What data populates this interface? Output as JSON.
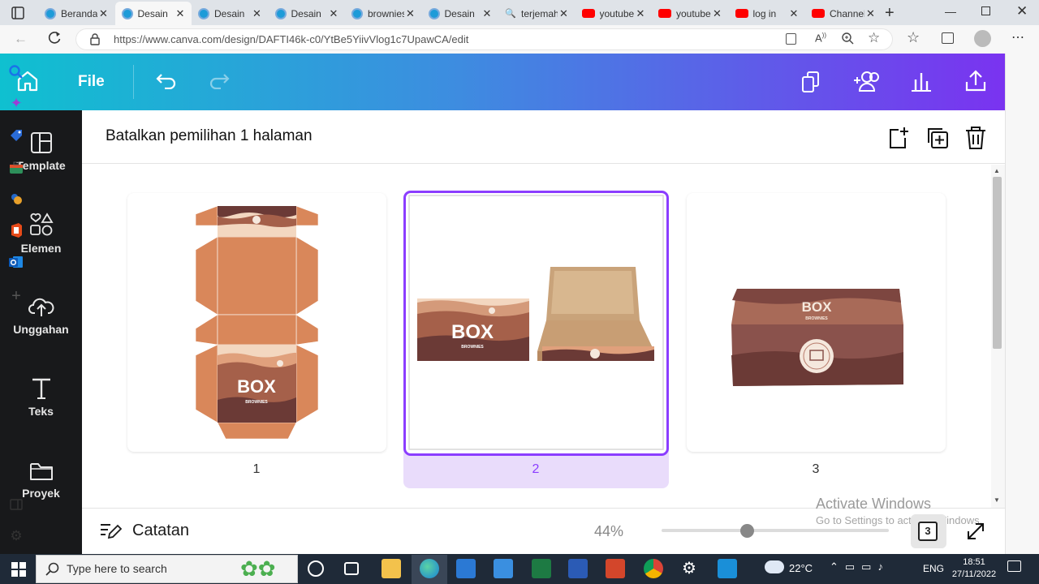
{
  "browser": {
    "tabs": [
      {
        "label": "Beranda",
        "icon": "canva-favicon",
        "active": false
      },
      {
        "label": "Desain",
        "icon": "canva-favicon",
        "active": true
      },
      {
        "label": "Desain",
        "icon": "canva-favicon",
        "active": false
      },
      {
        "label": "Desain",
        "icon": "canva-favicon",
        "active": false
      },
      {
        "label": "brownies",
        "icon": "canva-favicon",
        "active": false
      },
      {
        "label": "Desain",
        "icon": "canva-favicon",
        "active": false
      },
      {
        "label": "terjemahan",
        "icon": "search-icon",
        "active": false
      },
      {
        "label": "youtube",
        "icon": "youtube-favicon",
        "active": false
      },
      {
        "label": "youtube",
        "icon": "youtube-favicon",
        "active": false
      },
      {
        "label": "log in",
        "icon": "youtube-favicon",
        "active": false
      },
      {
        "label": "Channel",
        "icon": "youtube-favicon",
        "active": false
      }
    ],
    "url": "https://www.canva.com/design/DAFTI46k-c0/YtBe5YiivVlog1c7UpawCA/edit"
  },
  "header": {
    "file_label": "File"
  },
  "sidebar": {
    "items": [
      {
        "label": "Template",
        "icon": "template-icon"
      },
      {
        "label": "Elemen",
        "icon": "elements-icon"
      },
      {
        "label": "Unggahan",
        "icon": "upload-icon"
      },
      {
        "label": "Teks",
        "icon": "text-icon"
      },
      {
        "label": "Proyek",
        "icon": "folder-icon"
      }
    ]
  },
  "page_manager": {
    "selection_text": "Batalkan pemilihan 1 halaman",
    "pages": [
      {
        "number": "1",
        "brand": "BOX",
        "sub": "BROWNIES"
      },
      {
        "number": "2",
        "brand": "BOX",
        "sub": "BROWNIES"
      },
      {
        "number": "3",
        "brand": "BOX",
        "sub": "BROWNIES"
      }
    ],
    "selected_page": 2
  },
  "footer": {
    "notes_label": "Catatan",
    "zoom": "44%",
    "zoom_fraction": 0.38,
    "page_count": "3"
  },
  "watermark": {
    "title": "Activate Windows",
    "subtitle": "Go to Settings to activate Windows."
  },
  "taskbar": {
    "search_placeholder": "Type here to search",
    "temperature": "22°C",
    "language": "ENG",
    "time": "18:51",
    "date": "27/11/2022"
  },
  "colors": {
    "accent": "#8b3dff",
    "header_start": "#0fc0d0",
    "header_end": "#7a33f0",
    "box_brown": "#d9875a",
    "box_dark": "#6b3a36"
  }
}
